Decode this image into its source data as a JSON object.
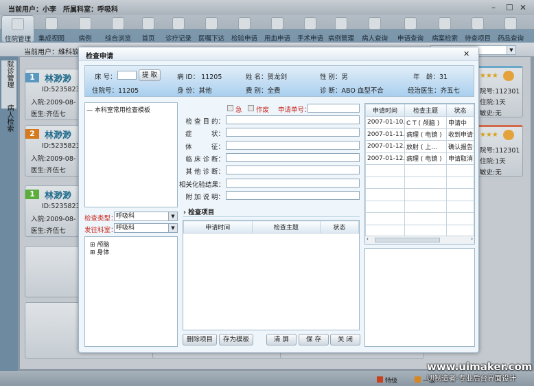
{
  "window": {
    "title": "当前用户：小李　所属科室：呼吸科",
    "minimize": "–",
    "maximize": "☐",
    "close": "✕"
  },
  "toolbar": [
    {
      "label": "住院管理",
      "icon": "gear-icon",
      "active": true
    },
    {
      "label": "集成视图",
      "icon": "grid-icon"
    },
    {
      "label": "病例",
      "icon": "clipboard-icon"
    },
    {
      "label": "综合浏览",
      "icon": "document-icon"
    },
    {
      "label": "首页",
      "icon": "home-icon"
    },
    {
      "label": "诊疗记录",
      "icon": "clipboard-icon"
    },
    {
      "label": "医嘱下达",
      "icon": "document-icon"
    },
    {
      "label": "检验申请",
      "icon": "gear-icon"
    },
    {
      "label": "用血申请",
      "icon": "notebook-icon"
    },
    {
      "label": "手术申请",
      "icon": "clipboard-icon"
    },
    {
      "label": "病例管理",
      "icon": "stack-icon"
    },
    {
      "label": "病人查询",
      "icon": "person-icon"
    },
    {
      "label": "申请查询",
      "icon": "gear-icon"
    },
    {
      "label": "病案检索",
      "icon": "document-icon"
    },
    {
      "label": "待查项目",
      "icon": "clipboard-icon"
    },
    {
      "label": "药品查询",
      "icon": "stack-icon"
    }
  ],
  "subbar": {
    "current_user": "当前用户：維科软件"
  },
  "leftnav": [
    {
      "label": "就诊管理"
    },
    {
      "label": "病人检索"
    }
  ],
  "cards": [
    {
      "num": "1",
      "name": "林渺渺",
      "id": "ID:5235823",
      "admit": "入院:2009-08-",
      "doctor": "医生:齐伍七",
      "color": "#5a98c0"
    },
    {
      "num": "2",
      "name": "林渺渺",
      "id": "ID:5235823",
      "admit": "入院:2009-08-",
      "doctor": "医生:齐伍七",
      "color": "#d57a1e"
    },
    {
      "num": "1",
      "name": "林渺渺",
      "id": "ID:5235823",
      "admit": "入院:2009-08-",
      "doctor": "医生:齐伍七",
      "color": "#5cae3c"
    }
  ],
  "right_cards": [
    {
      "stars": "★★★",
      "hosp_no": "院号:112301",
      "days": "住院:1天",
      "allergy": "敏史:无",
      "color": "#6aa8c8"
    },
    {
      "stars": "★★★",
      "hosp_no": "院号:112301",
      "days": "住院:1天",
      "allergy": "敏史:无",
      "color": "#d2694a"
    }
  ],
  "dialog": {
    "title": "检查申请",
    "close": "✕",
    "info": {
      "bed_label": "床 号：",
      "fetch": "提 取",
      "case_id": "病 ID： 11205",
      "name": "姓 名：贺龙剑",
      "sex": "性 别：男",
      "age": "年　龄：31",
      "hosp_no": "住院号：11205",
      "identity": "身 份：其他",
      "fee": "费 别：全费",
      "diagnosis": "诊 断：ABO 血型不合",
      "doctor": "经治医生：齐五七"
    },
    "template_tree": "本科室常用检查模板",
    "exam_type_label": "检查类型：",
    "exam_type": "呼吸科",
    "dept_label": "发往科室：",
    "dept": "呼吸科",
    "body_tree": [
      "颅脑",
      "身体"
    ],
    "urgent": "急",
    "void": "作废",
    "req_no_label": "申请单号：",
    "fields": [
      "检 查 目 的：",
      "症　　　状：",
      "体　　　征：",
      "临 床 诊 断：",
      "其 他 诊 断：",
      "相关化验结果：",
      "附 加 说 明："
    ],
    "items_title": "检查项目",
    "items_headers": [
      "申请时间",
      "检查主题",
      "状态"
    ],
    "buttons": {
      "delete": "删除项目",
      "save_tpl": "存为模板",
      "clear": "清 屏",
      "save": "保 存",
      "close": "关 闭"
    },
    "history_headers": [
      "申请时间",
      "检查主题",
      "状态"
    ],
    "history_rows": [
      [
        "2007-01-10.",
        "C T ( 颅脑 )",
        "申请中"
      ],
      [
        "2007-01-11.",
        "病理 ( 电镜 )",
        "收到申请"
      ],
      [
        "2007-01-12.",
        "放射 ( 上...",
        "确认报告"
      ],
      [
        "2007-01-12.",
        "病理 ( 电镜 )",
        "申请取消"
      ]
    ]
  },
  "legend": [
    {
      "label": "特级",
      "color": "#c8401c"
    },
    {
      "label": "一级",
      "color": "#d8861e"
    }
  ],
  "watermark": {
    "line1": "www.uimaker.com",
    "line2": "UI制造者-专业后台界面设计"
  }
}
